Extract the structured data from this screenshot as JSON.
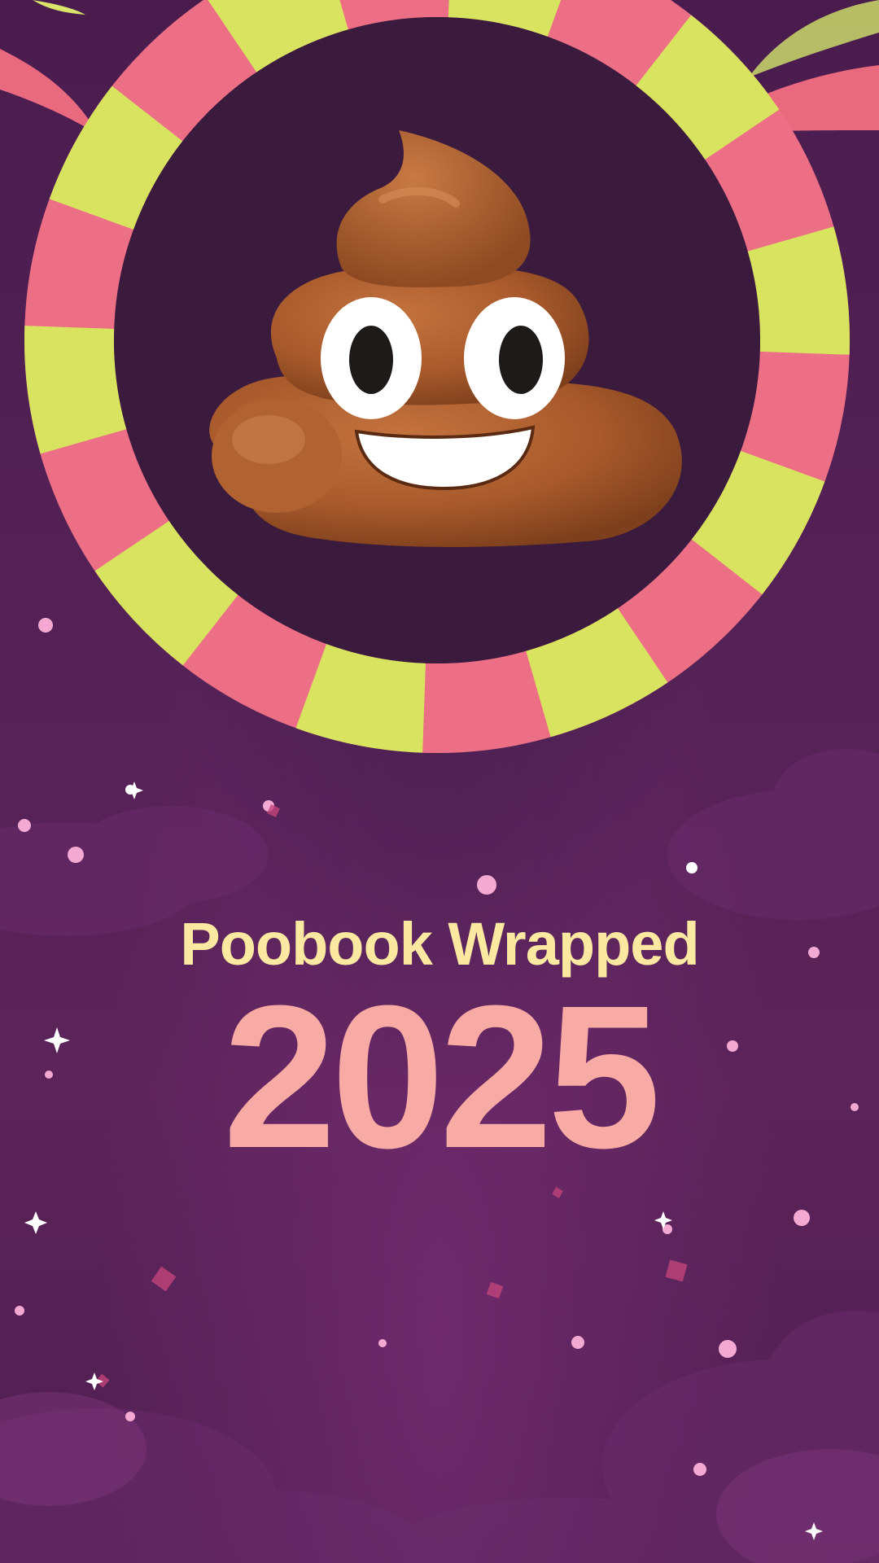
{
  "screen": {
    "subtitle": "Poobook Wrapped",
    "year": "2025"
  },
  "emblem": {
    "icon": "pile-of-poo-icon",
    "ring_colors": [
      "#ec6f86",
      "#d8e35f"
    ],
    "inner_color": "#3a1a3d"
  },
  "colors": {
    "background": "#4f1f52",
    "subtitle": "#fbe9a2",
    "year": "#f8aaa5"
  }
}
